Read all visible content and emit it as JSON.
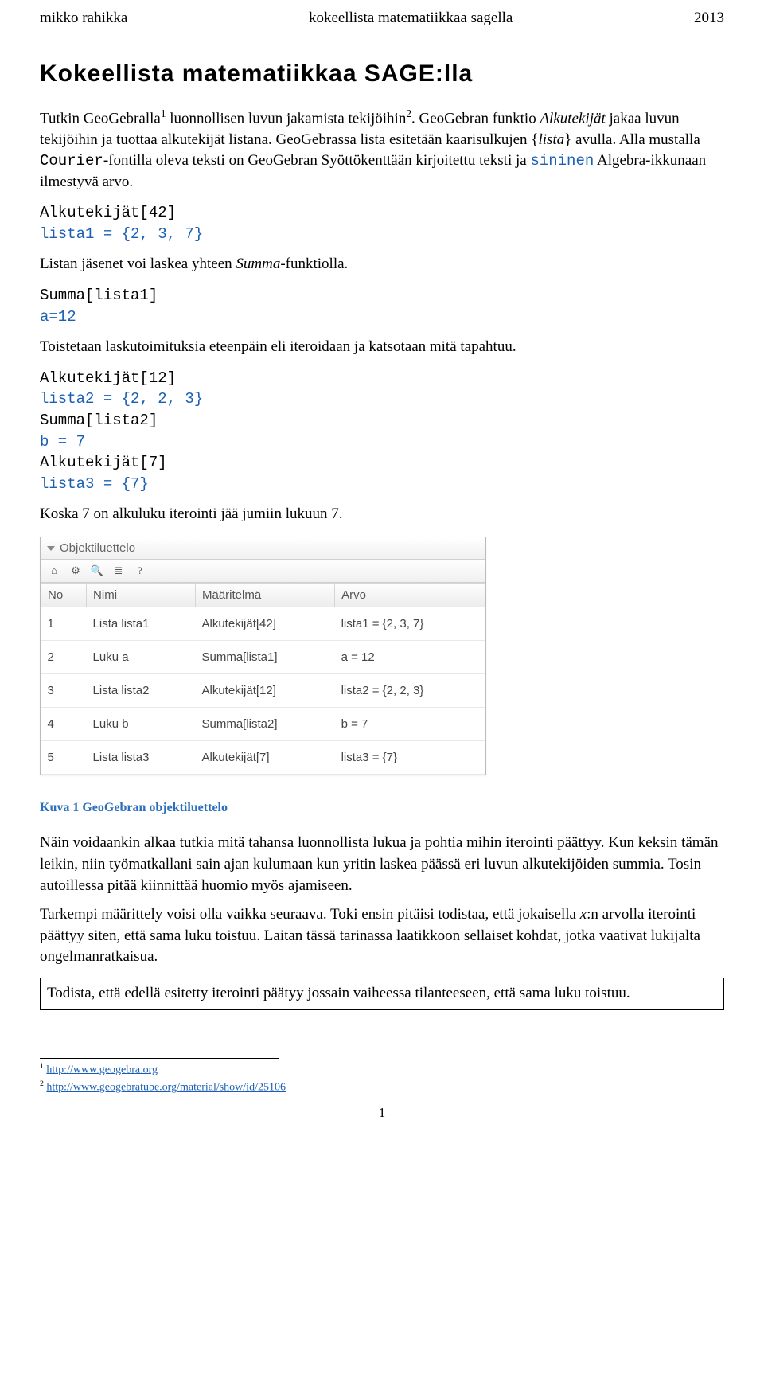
{
  "header": {
    "left": "mikko rahikka",
    "center": "kokeellista matematiikkaa sagella",
    "right": "2013"
  },
  "title": "Kokeellista matematiikkaa SAGE:lla",
  "p1_a": "Tutkin GeoGebralla",
  "p1_b": " luonnollisen luvun jakamista tekijöihin",
  "p1_c": ". GeoGebran funktio ",
  "p1_alku": "Alkutekijät",
  "p1_d": " jakaa luvun tekijöihin ja tuottaa alkutekijät listana. GeoGebrassa lista esitetään kaarisulkujen {",
  "p1_lista": "lista",
  "p1_e": "} avulla. Alla mustalla ",
  "p1_courier": "Courier",
  "p1_f": "-fontilla oleva teksti on GeoGebran Syöttökenttään kirjoitettu teksti ja ",
  "p1_sininen": "sininen",
  "p1_g": " Algebra-ikkunaan ilmestyvä arvo.",
  "code1_l1": "Alkutekijät[42]",
  "code1_l2": "lista1 = {2, 3, 7}",
  "p2_a": "Listan jäsenet voi laskea yhteen ",
  "p2_summa": "Summa",
  "p2_b": "-funktiolla.",
  "code2_l1": "Summa[lista1]",
  "code2_l2": "a=12",
  "p3": "Toistetaan laskutoimituksia eteenpäin eli iteroidaan ja katsotaan mitä tapahtuu.",
  "code3_l1": "Alkutekijät[12]",
  "code3_l2": "lista2 = {2, 2, 3}",
  "code3_l3": "Summa[lista2]",
  "code3_l4": "b = 7",
  "code3_l5": "Alkutekijät[7]",
  "code3_l6": "lista3 = {7}",
  "p4": "Koska 7 on alkuluku iterointi jää jumiin lukuun 7.",
  "panel": {
    "title": "Objektiluettelo",
    "columns": [
      "No",
      "Nimi",
      "Määritelmä",
      "Arvo"
    ],
    "rows": [
      {
        "no": "1",
        "nimi": "Lista lista1",
        "def": "Alkutekijät[42]",
        "arvo": "lista1 = {2, 3, 7}"
      },
      {
        "no": "2",
        "nimi": "Luku a",
        "def": "Summa[lista1]",
        "arvo": "a = 12"
      },
      {
        "no": "3",
        "nimi": "Lista lista2",
        "def": "Alkutekijät[12]",
        "arvo": "lista2 = {2, 2, 3}"
      },
      {
        "no": "4",
        "nimi": "Luku b",
        "def": "Summa[lista2]",
        "arvo": "b = 7"
      },
      {
        "no": "5",
        "nimi": "Lista lista3",
        "def": "Alkutekijät[7]",
        "arvo": "lista3 = {7}"
      }
    ]
  },
  "caption": "Kuva 1 GeoGebran objektiluettelo",
  "p5": "Näin voidaankin alkaa tutkia mitä tahansa luonnollista lukua ja pohtia mihin iterointi päättyy. Kun keksin tämän leikin, niin työmatkallani sain ajan kulumaan kun yritin laskea päässä eri luvun alkutekijöiden summia. Tosin autoillessa pitää kiinnittää huomio myös ajamiseen.",
  "p6_a": "Tarkempi määrittely voisi olla vaikka seuraava. Toki ensin pitäisi todistaa, että jokaisella ",
  "p6_x": "x",
  "p6_b": ":n arvolla iterointi päättyy siten, että sama luku toistuu. Laitan tässä tarinassa laatikkoon sellaiset kohdat, jotka vaativat lukijalta ongelmanratkaisua.",
  "boxed": "Todista, että edellä esitetty iterointi päätyy jossain vaiheessa tilanteeseen, että sama luku toistuu.",
  "fn1_sup": "1",
  "fn1_url": "http://www.geogebra.org",
  "fn2_sup": "2",
  "fn2_url": "http://www.geogebratube.org/material/show/id/25106",
  "page_num": "1"
}
